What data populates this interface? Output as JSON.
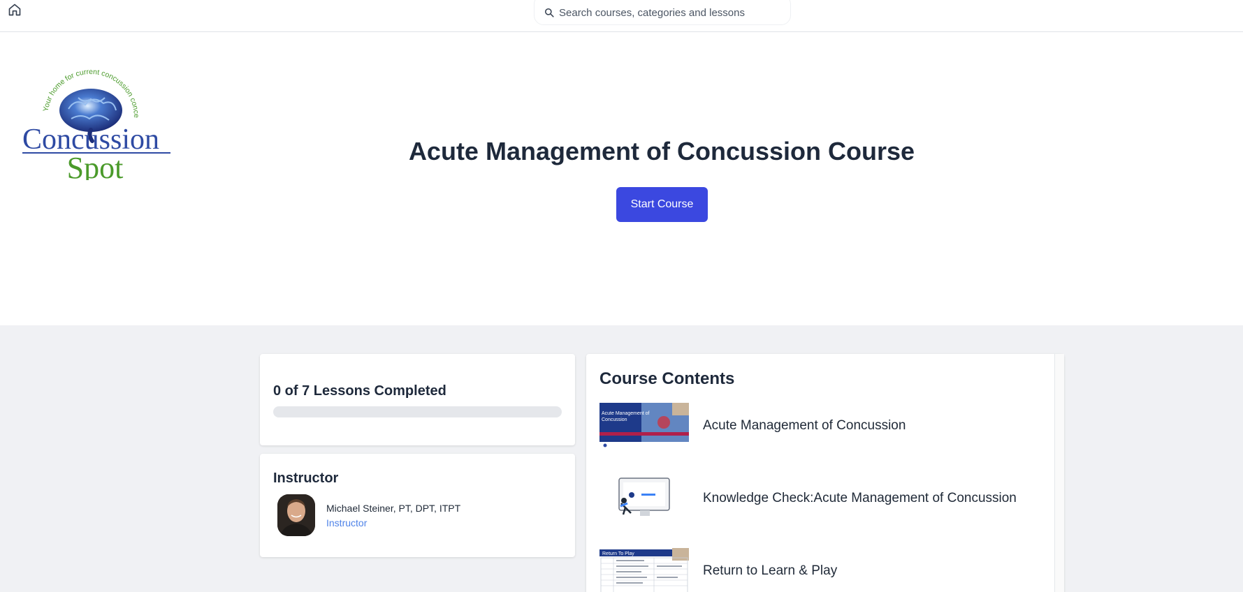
{
  "search": {
    "placeholder": "Search courses, categories and lessons"
  },
  "logo": {
    "tagline": "Your home for current concussion concepts",
    "word1": "Concussion",
    "word2": "Spot"
  },
  "hero": {
    "title": "Acute Management of Concussion Course",
    "start_label": "Start Course"
  },
  "progress": {
    "label": "0 of 7 Lessons Completed",
    "completed": 0,
    "total": 7
  },
  "instructor": {
    "heading": "Instructor",
    "name": "Michael Steiner, PT, DPT, ITPT",
    "role": "Instructor"
  },
  "contents": {
    "heading": "Course Contents",
    "lessons": [
      {
        "title": "Acute Management of Concussion",
        "thumb_text": "Acute Management of Concussion"
      },
      {
        "title": "Knowledge Check:Acute Management of Concussion"
      },
      {
        "title": "Return to Learn & Play",
        "thumb_text": "Return To Play"
      }
    ]
  },
  "colors": {
    "accent": "#3b48e0",
    "link": "#4f83e8",
    "lower_bg": "#f0f1f4",
    "title": "#1e293b"
  },
  "icons": {
    "home": "home-icon",
    "search": "search-icon"
  }
}
